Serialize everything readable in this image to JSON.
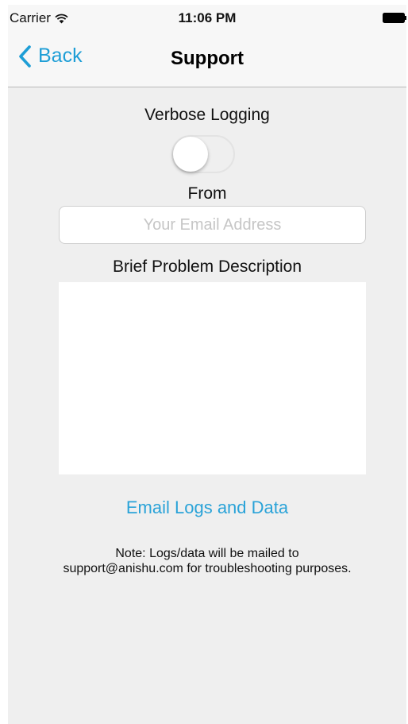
{
  "status_bar": {
    "carrier": "Carrier",
    "time": "11:06 PM",
    "icons": [
      "wifi-icon",
      "battery-icon"
    ]
  },
  "nav": {
    "back_label": "Back",
    "title": "Support",
    "accent_color": "#1e9ed6"
  },
  "form": {
    "verbose_label": "Verbose Logging",
    "verbose_on": false,
    "from_label": "From",
    "email_value": "",
    "email_placeholder": "Your Email Address",
    "description_label": "Brief Problem Description",
    "description_value": ""
  },
  "actions": {
    "email_logs_label": "Email Logs and Data"
  },
  "note": {
    "line1": "Note: Logs/data will be mailed to",
    "line2": "support@anishu.com for troubleshooting purposes."
  }
}
